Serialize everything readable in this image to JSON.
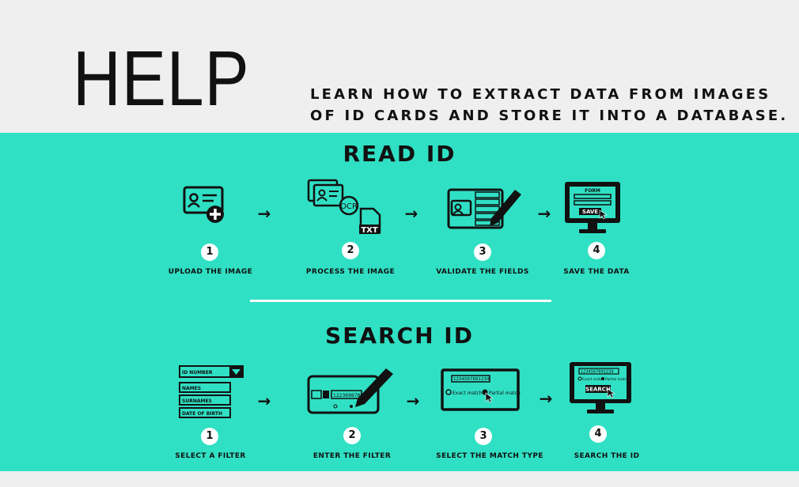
{
  "header": {
    "title": "HELP",
    "subtitle_line1": "LEARN HOW TO EXTRACT DATA FROM IMAGES",
    "subtitle_line2": "OF ID CARDS AND STORE IT INTO A DATABASE."
  },
  "colors": {
    "panel": "#30e0c4",
    "background": "#efefef",
    "ink": "#111111"
  },
  "read_id": {
    "title": "READ ID",
    "arrow": "→",
    "steps": [
      {
        "number": "1",
        "caption": "UPLOAD THE IMAGE",
        "icon": "id-card-add-icon"
      },
      {
        "number": "2",
        "caption": "PROCESS THE IMAGE",
        "icon": "ocr-txt-icon",
        "icon_text_ocr": "OCR",
        "icon_text_txt": "TXT"
      },
      {
        "number": "3",
        "caption": "VALIDATE THE FIELDS",
        "icon": "id-card-edit-icon"
      },
      {
        "number": "4",
        "caption": "SAVE THE DATA",
        "icon": "monitor-form-save-icon",
        "icon_text_form": "FORM",
        "icon_text_save": "SAVE"
      }
    ]
  },
  "search_id": {
    "title": "SEARCH ID",
    "arrow": "→",
    "steps": [
      {
        "number": "1",
        "caption": "SELECT A FILTER",
        "icon": "filter-list-icon",
        "fields": [
          "ID NUMBER",
          "NAMES",
          "SURNAMES",
          "DATE OF BIRTH"
        ]
      },
      {
        "number": "2",
        "caption": "ENTER THE FILTER",
        "icon": "card-input-edit-icon",
        "icon_text_value": "12236987896"
      },
      {
        "number": "3",
        "caption": "SELECT THE MATCH TYPE",
        "icon": "match-type-icon",
        "icon_text_value": "1234567891234",
        "option_exact": "Exact match",
        "option_partial": "Partial match"
      },
      {
        "number": "4",
        "caption": "SEARCH THE ID",
        "icon": "monitor-search-icon",
        "icon_text_value": "1234567891234",
        "option_exact": "Exact match",
        "option_partial": "Partial match",
        "icon_text_search": "SEARCH"
      }
    ]
  }
}
